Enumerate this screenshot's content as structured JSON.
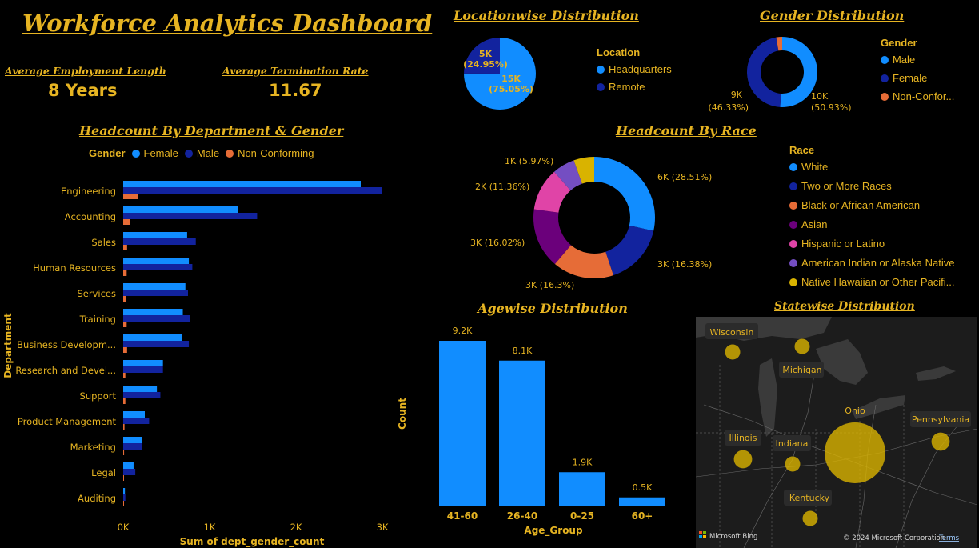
{
  "dashboard": {
    "title": "Workforce Analytics Dashboard",
    "kpis": [
      {
        "label": "Average Employment Length",
        "value": "8 Years"
      },
      {
        "label": "Average Termination Rate",
        "value": "11.67"
      }
    ]
  },
  "colors": {
    "gold": "#e6b422",
    "female": "#118dff",
    "male": "#12239e",
    "non_conforming": "#e66c37",
    "asian": "#6b007b",
    "hispanic": "#e044a7",
    "american_indian": "#744ec2",
    "hawaiian": "#d9b300",
    "background": "#000000"
  },
  "location": {
    "title": "Locationwise Distribution",
    "legend_title": "Location",
    "slice_labels": [
      {
        "line1": "5K",
        "line2": "(24.95%)"
      },
      {
        "line1": "15K",
        "line2": "(75.05%)"
      }
    ]
  },
  "gender": {
    "title": "Gender Distribution",
    "legend_title": "Gender",
    "legend_labels": [
      "Male",
      "Female",
      "Non-Confor..."
    ],
    "slice_labels": [
      {
        "line1": "10K",
        "line2": "(50.93%)"
      },
      {
        "line1": "9K",
        "line2": "(46.33%)"
      }
    ]
  },
  "dept": {
    "title": "Headcount By Department & Gender",
    "legend_title": "Gender",
    "xlabel": "Sum of dept_gender_count",
    "ylabel": "Department",
    "tick_labels": [
      "0K",
      "1K",
      "2K",
      "3K"
    ],
    "category_labels": [
      "Engineering",
      "Accounting",
      "Sales",
      "Human Resources",
      "Services",
      "Training",
      "Business Developm...",
      "Research and Devel...",
      "Support",
      "Product Management",
      "Marketing",
      "Legal",
      "Auditing"
    ]
  },
  "race": {
    "title": "Headcount By Race",
    "legend_title": "Race",
    "legend_labels": [
      "White",
      "Two or More Races",
      "Black or African American",
      "Asian",
      "Hispanic or Latino",
      "American Indian or Alaska Native",
      "Native Hawaiian or Other Pacifi..."
    ],
    "slice_labels": [
      "6K (28.51%)",
      "3K (16.38%)",
      "3K (16.3%)",
      "3K (16.02%)",
      "2K (11.36%)",
      "1K (5.97%)"
    ]
  },
  "age": {
    "title": "Agewise Distribution",
    "xlabel": "Age_Group",
    "ylabel": "Count"
  },
  "state_map": {
    "title": "Statewise Distribution",
    "bubble_labels": [
      "Wisconsin",
      "Michigan",
      "Illinois",
      "Indiana",
      "Ohio",
      "Pennsylvania",
      "Kentucky"
    ],
    "attribution_brand": "Microsoft Bing",
    "copyright": "© 2024 Microsoft Corporation",
    "terms_link": "Terms"
  },
  "chart_data": [
    {
      "type": "pie",
      "title": "Locationwise Distribution",
      "legend_placement": "right",
      "categories": [
        "Headquarters",
        "Remote"
      ],
      "values": [
        15000,
        5000
      ],
      "percentages": [
        75.05,
        24.95
      ],
      "colors": [
        "#118dff",
        "#12239e"
      ]
    },
    {
      "type": "pie",
      "title": "Gender Distribution",
      "donut": true,
      "legend_placement": "right",
      "categories": [
        "Male",
        "Female",
        "Non-Conforming"
      ],
      "values": [
        10000,
        9000,
        550
      ],
      "percentages": [
        50.93,
        46.33,
        2.74
      ],
      "colors": [
        "#118dff",
        "#12239e",
        "#e66c37"
      ]
    },
    {
      "type": "bar",
      "orientation": "horizontal",
      "title": "Headcount By Department & Gender",
      "xlabel": "Sum of dept_gender_count",
      "ylabel": "Department",
      "xlim": [
        0,
        3000
      ],
      "legend_placement": "top",
      "categories": [
        "Engineering",
        "Accounting",
        "Sales",
        "Human Resources",
        "Services",
        "Training",
        "Business Developm...",
        "Research and Devel...",
        "Support",
        "Product Management",
        "Marketing",
        "Legal",
        "Auditing"
      ],
      "series": [
        {
          "name": "Female",
          "color": "#118dff",
          "values": [
            2750,
            1330,
            740,
            760,
            720,
            690,
            680,
            460,
            390,
            250,
            220,
            120,
            20
          ]
        },
        {
          "name": "Male",
          "color": "#12239e",
          "values": [
            3000,
            1550,
            840,
            800,
            750,
            770,
            760,
            460,
            430,
            300,
            220,
            140,
            25
          ]
        },
        {
          "name": "Non-Conforming",
          "color": "#e66c37",
          "values": [
            170,
            80,
            45,
            40,
            35,
            40,
            45,
            25,
            25,
            15,
            10,
            8,
            3
          ]
        }
      ]
    },
    {
      "type": "pie",
      "title": "Headcount By Race",
      "donut": true,
      "legend_placement": "right",
      "categories": [
        "White",
        "Two or More Races",
        "Black or African American",
        "Asian",
        "Hispanic or Latino",
        "American Indian or Alaska Native",
        "Native Hawaiian or Other Pacifi..."
      ],
      "values": [
        6000,
        3000,
        3000,
        3000,
        2000,
        1000,
        1000
      ],
      "percentages": [
        28.51,
        16.38,
        16.3,
        16.02,
        11.36,
        5.97,
        5.46
      ],
      "colors": [
        "#118dff",
        "#12239e",
        "#e66c37",
        "#6b007b",
        "#e044a7",
        "#744ec2",
        "#d9b300"
      ]
    },
    {
      "type": "bar",
      "title": "Agewise Distribution",
      "xlabel": "Age_Group",
      "ylabel": "Count",
      "categories": [
        "41-60",
        "26-40",
        "0-25",
        "60+"
      ],
      "values": [
        9200,
        8100,
        1900,
        500
      ],
      "data_labels": [
        "9.2K",
        "8.1K",
        "1.9K",
        "0.5K"
      ],
      "ylim": [
        0,
        9200
      ],
      "color": "#118dff"
    },
    {
      "type": "scatter",
      "subtype": "bubble_map",
      "title": "Statewise Distribution",
      "categories": [
        "Wisconsin",
        "Michigan",
        "Illinois",
        "Indiana",
        "Ohio",
        "Pennsylvania",
        "Kentucky"
      ],
      "relative_size": [
        1,
        1,
        1.2,
        1,
        4,
        1.2,
        1
      ]
    }
  ]
}
